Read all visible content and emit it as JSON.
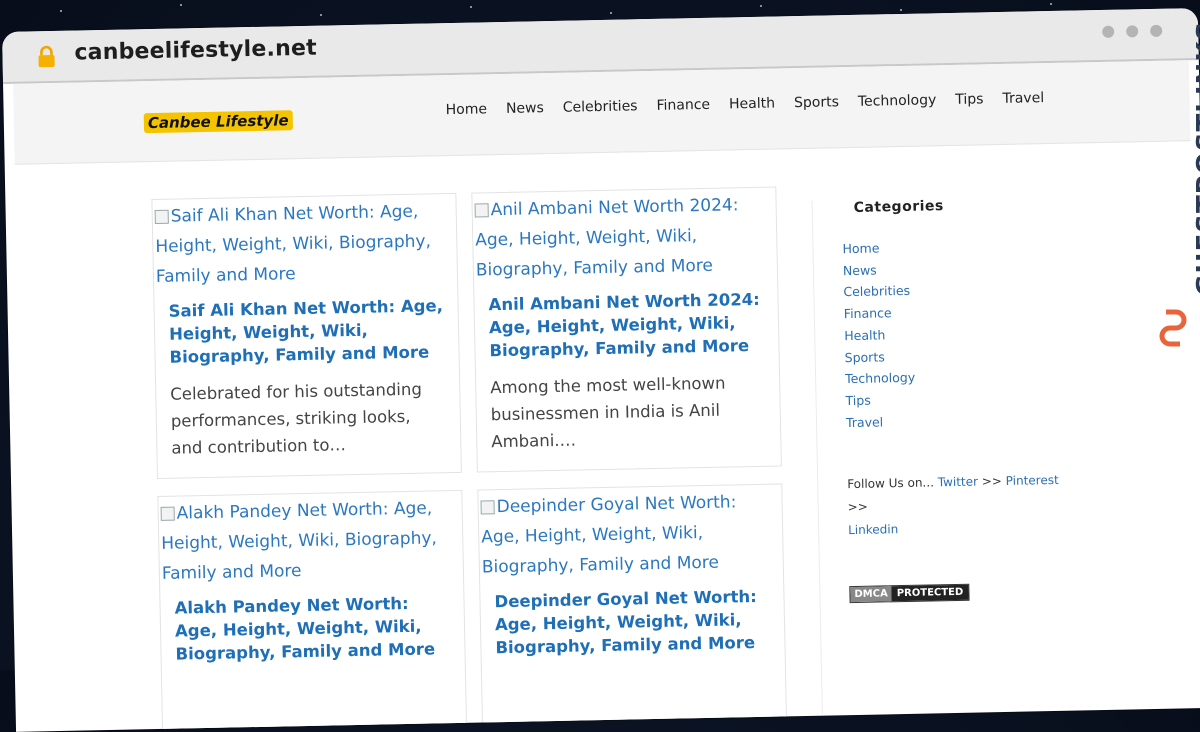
{
  "browser": {
    "url": "canbeelifestyle.net"
  },
  "site": {
    "logo": "Canbee Lifestyle",
    "nav": [
      "Home",
      "News",
      "Celebrities",
      "Finance",
      "Health",
      "Sports",
      "Technology",
      "Tips",
      "Travel"
    ]
  },
  "posts": [
    {
      "image_alt": "Saif Ali Khan Net Worth: Age, Height, Weight, Wiki, Biography, Family and More",
      "title": "Saif Ali Khan Net Worth: Age, Height, Weight, Wiki, Biography, Family and More",
      "excerpt": "Celebrated for his outstanding performances, striking looks, and contribution to…"
    },
    {
      "image_alt": "Anil Ambani Net Worth 2024: Age, Height, Weight, Wiki, Biography, Family and More",
      "title": "Anil Ambani Net Worth 2024: Age, Height, Weight, Wiki, Biography, Family and More",
      "excerpt": "Among the most well-known businessmen in India is Anil Ambani.…"
    },
    {
      "image_alt": "Alakh Pandey Net Worth: Age, Height, Weight, Wiki, Biography, Family and More",
      "title": "Alakh Pandey Net Worth: Age, Height, Weight, Wiki, Biography, Family and More",
      "excerpt": ""
    },
    {
      "image_alt": "Deepinder Goyal Net Worth: Age, Height, Weight, Wiki, Biography, Family and More",
      "title": "Deepinder Goyal Net Worth: Age, Height, Weight, Wiki, Biography, Family and More",
      "excerpt": ""
    }
  ],
  "sidebar": {
    "heading": "Categories",
    "categories": [
      "Home",
      "News",
      "Celebrities",
      "Finance",
      "Health",
      "Sports",
      "Technology",
      "Tips",
      "Travel"
    ],
    "follow_prefix": "Follow Us on...",
    "follow_links": [
      "Twitter",
      "Pinterest",
      "Linkedin"
    ],
    "follow_separator": ">>",
    "dmca_left": "DMCA",
    "dmca_right": "PROTECTED"
  },
  "watermark": "GUESTPOSTLINKS",
  "colors": {
    "link": "#2b78c0",
    "title": "#1f6fb7",
    "logo_bg": "#f5c400",
    "watermark": "#2a3a55",
    "watermark_icon": "#e8643a"
  }
}
